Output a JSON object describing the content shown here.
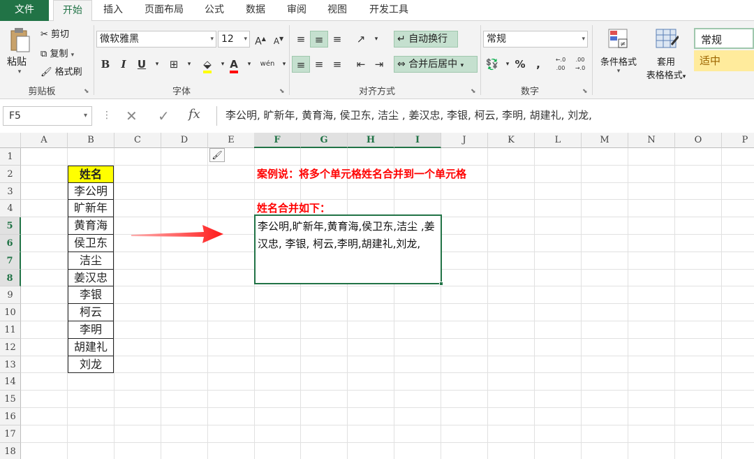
{
  "tabs": [
    "文件",
    "开始",
    "插入",
    "页面布局",
    "公式",
    "数据",
    "审阅",
    "视图",
    "开发工具"
  ],
  "ribbon": {
    "clipboard": {
      "paste": "粘贴",
      "cut": "剪切",
      "copy": "复制",
      "format_painter": "格式刷",
      "label": "剪贴板"
    },
    "font": {
      "name": "微软雅黑",
      "size": "12",
      "label": "字体",
      "bold": "B",
      "italic": "I",
      "underline": "U",
      "grow": "A",
      "shrink": "A",
      "font_color": "A",
      "phonetic": "wén"
    },
    "alignment": {
      "wrap_text": "自动换行",
      "merge_center": "合并后居中",
      "label": "对齐方式"
    },
    "number": {
      "format": "常规",
      "percent": "%",
      "comma": ",",
      "inc_decimal": ".0→.00",
      "dec_decimal": ".00→.0",
      "label": "数字"
    },
    "styles": {
      "conditional": "条件格式",
      "table_format": "套用",
      "table_format2": "表格格式",
      "style_normal": "常规",
      "style_neutral": "适中"
    }
  },
  "formula_bar": {
    "name_box": "F5",
    "content": "李公明, 旷新年, 黄育海, 侯卫东, 洁尘    , 姜汉忠,     李银,     柯云, 李明, 胡建礼, 刘龙,",
    "fx": "fx"
  },
  "columns": [
    "A",
    "B",
    "C",
    "D",
    "E",
    "F",
    "G",
    "H",
    "I",
    "J",
    "K",
    "L",
    "M",
    "N",
    "O",
    "P"
  ],
  "rows": [
    "1",
    "2",
    "3",
    "4",
    "5",
    "6",
    "7",
    "8",
    "9",
    "10",
    "11",
    "12",
    "13",
    "14",
    "15",
    "16",
    "17",
    "18"
  ],
  "sheet": {
    "header": "姓名",
    "names": [
      "李公明",
      "旷新年",
      "黄育海",
      "侯卫东",
      "洁尘",
      "姜汉忠",
      "李银",
      "柯云",
      "李明",
      "胡建礼",
      "刘龙"
    ],
    "title": "案例说：将多个单元格姓名合并到一个单元格",
    "subtitle": "姓名合并如下：",
    "merged": "李公明,旷新年,黄育海,侯卫东,洁尘 ,姜汉忠, 李银, 柯云,李明,胡建礼,刘龙,"
  },
  "colors": {
    "accent": "#217346",
    "highlight": "#ffff00",
    "red": "#ff0000",
    "neutral_style": "#ffeb9c"
  }
}
